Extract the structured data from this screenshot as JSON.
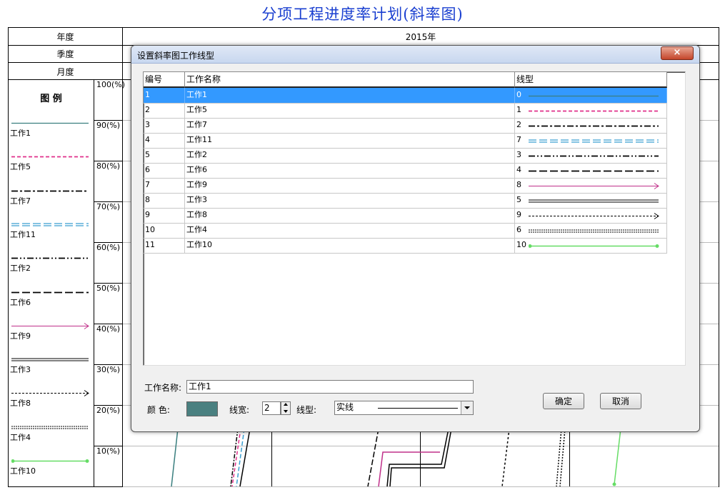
{
  "title": "分项工程进度率计划(斜率图)",
  "header": {
    "year_label": "年度",
    "quarter_label": "季度",
    "month_label": "月度",
    "year_value": "2015年"
  },
  "legend": {
    "heading": "图 例",
    "items": [
      {
        "name": "工作1",
        "color": "#3a7f7f",
        "style": "solid"
      },
      {
        "name": "工作5",
        "color": "#e0308a",
        "style": "dash"
      },
      {
        "name": "工作7",
        "color": "#000000",
        "style": "dashdot"
      },
      {
        "name": "工作11",
        "color": "#3a9fd0",
        "style": "double-dash"
      },
      {
        "name": "工作2",
        "color": "#000000",
        "style": "dashdotdot"
      },
      {
        "name": "工作6",
        "color": "#000000",
        "style": "longdash"
      },
      {
        "name": "工作9",
        "color": "#c0308a",
        "style": "arrow"
      },
      {
        "name": "工作3",
        "color": "#000000",
        "style": "double"
      },
      {
        "name": "工作8",
        "color": "#000000",
        "style": "dot-arrow"
      },
      {
        "name": "工作4",
        "color": "#000000",
        "style": "dense-dot"
      },
      {
        "name": "工作10",
        "color": "#66dd66",
        "style": "dot-ends"
      }
    ]
  },
  "percent_axis": [
    "100(%)",
    "90(%)",
    "80(%)",
    "70(%)",
    "60(%)",
    "50(%)",
    "40(%)",
    "30(%)",
    "20(%)",
    "10(%)"
  ],
  "dialog": {
    "title": "设置斜率图工作线型",
    "close_label": "×",
    "columns": [
      "编号",
      "工作名称",
      "线型"
    ],
    "rows": [
      {
        "id": "1",
        "name": "工作1",
        "type": "0",
        "color": "#3a7f7f",
        "style": "solid",
        "selected": true
      },
      {
        "id": "2",
        "name": "工作5",
        "type": "1",
        "color": "#e0308a",
        "style": "dash"
      },
      {
        "id": "3",
        "name": "工作7",
        "type": "2",
        "color": "#000000",
        "style": "dashdot"
      },
      {
        "id": "4",
        "name": "工作11",
        "type": "7",
        "color": "#3a9fd0",
        "style": "double-dash"
      },
      {
        "id": "5",
        "name": "工作2",
        "type": "3",
        "color": "#000000",
        "style": "dashdotdot"
      },
      {
        "id": "6",
        "name": "工作6",
        "type": "4",
        "color": "#000000",
        "style": "longdash"
      },
      {
        "id": "7",
        "name": "工作9",
        "type": "8",
        "color": "#c0308a",
        "style": "arrow"
      },
      {
        "id": "8",
        "name": "工作3",
        "type": "5",
        "color": "#000000",
        "style": "double"
      },
      {
        "id": "9",
        "name": "工作8",
        "type": "9",
        "color": "#000000",
        "style": "dot-arrow"
      },
      {
        "id": "10",
        "name": "工作4",
        "type": "6",
        "color": "#000000",
        "style": "dense-dot"
      },
      {
        "id": "11",
        "name": "工作10",
        "type": "10",
        "color": "#66dd66",
        "style": "dot-ends"
      }
    ],
    "form": {
      "name_label": "工作名称:",
      "name_value": "工作1",
      "color_label": "颜 色:",
      "color_value": "#4a8080",
      "width_label": "线宽:",
      "width_value": "2",
      "type_label": "线型:",
      "type_value": "实线",
      "ok_label": "确定",
      "cancel_label": "取消"
    }
  }
}
